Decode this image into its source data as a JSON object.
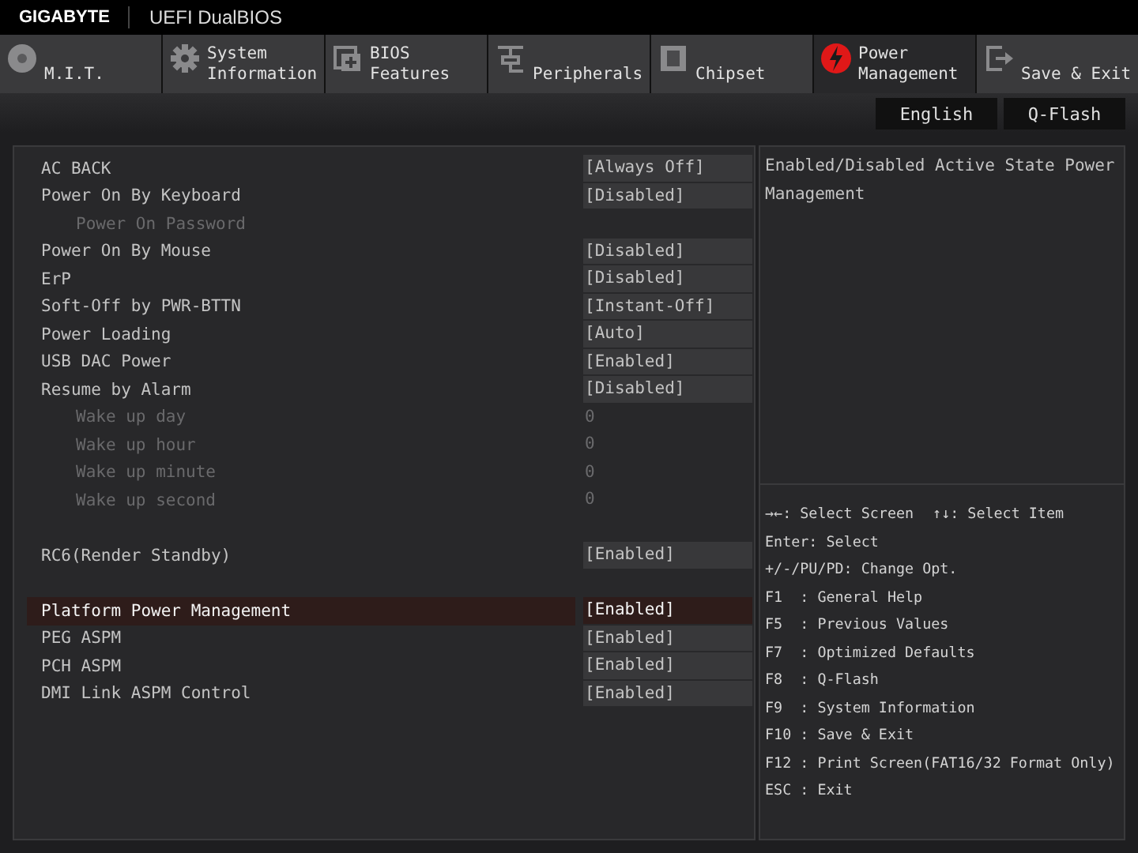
{
  "header": {
    "brand": "GIGABYTE",
    "product": "UEFI DualBIOS"
  },
  "tabs": [
    {
      "label": "M.I.T.",
      "selected": false
    },
    {
      "label": "System Information",
      "selected": false
    },
    {
      "label": "BIOS Features",
      "selected": false
    },
    {
      "label": "Peripherals",
      "selected": false
    },
    {
      "label": "Chipset",
      "selected": false
    },
    {
      "label": "Power Management",
      "selected": true
    },
    {
      "label": "Save & Exit",
      "selected": false
    }
  ],
  "top_buttons": [
    "English",
    "Q-Flash"
  ],
  "settings": [
    [
      {
        "label": "AC BACK",
        "value": "[Always Off]",
        "disabled": false,
        "selected": false
      },
      {
        "label": "Power On By Keyboard",
        "value": "[Disabled]",
        "disabled": false,
        "selected": false,
        "children": [
          {
            "label": "Power On Password",
            "disabled": true,
            "selected": false
          }
        ]
      },
      {
        "label": "Power On By Mouse",
        "value": "[Disabled]",
        "disabled": false,
        "selected": false
      },
      {
        "label": "ErP",
        "value": "[Disabled]",
        "disabled": false,
        "selected": false
      },
      {
        "label": "Soft-Off by PWR-BTTN",
        "value": "[Instant-Off]",
        "disabled": false,
        "selected": false
      },
      {
        "label": "Power Loading",
        "value": "[Auto]",
        "disabled": false,
        "selected": false
      },
      {
        "label": "USB DAC Power",
        "value": "[Enabled]",
        "disabled": false,
        "selected": false
      },
      {
        "label": "Resume by Alarm",
        "value": "[Disabled]",
        "disabled": false,
        "selected": false,
        "children": [
          {
            "label": "Wake up day",
            "value": "0",
            "disabled": true,
            "selected": false
          },
          {
            "label": "Wake up hour",
            "value": "0",
            "disabled": true,
            "selected": false
          },
          {
            "label": "Wake up minute",
            "value": "0",
            "disabled": true,
            "selected": false
          },
          {
            "label": "Wake up second",
            "value": "0",
            "disabled": true,
            "selected": false
          }
        ]
      }
    ],
    [
      {
        "label": "RC6(Render Standby)",
        "value": "[Enabled]",
        "disabled": false,
        "selected": false
      }
    ],
    [
      {
        "label": "Platform Power Management",
        "value": "[Enabled]",
        "disabled": false,
        "selected": true
      },
      {
        "label": "PEG ASPM",
        "value": "[Enabled]",
        "disabled": false,
        "selected": false
      },
      {
        "label": "PCH ASPM",
        "value": "[Enabled]",
        "disabled": false,
        "selected": false
      },
      {
        "label": "DMI Link ASPM Control",
        "value": "[Enabled]",
        "disabled": false,
        "selected": false
      }
    ]
  ],
  "description": "Enabled/Disabled Active State Power Management",
  "help": [
    [
      "→←: Select Screen",
      "↑↓: Select Item"
    ],
    [
      "Enter: Select"
    ],
    [
      "+/-/PU/PD: Change Opt."
    ],
    [
      "F1  : General Help"
    ],
    [
      "F5  : Previous Values"
    ],
    [
      "F7  : Optimized Defaults"
    ],
    [
      "F8  : Q-Flash"
    ],
    [
      "F9  : System Information"
    ],
    [
      "F10 : Save & Exit"
    ],
    [
      "F12 : Print Screen(FAT16/32 Format Only)"
    ],
    [
      "ESC : Exit"
    ]
  ]
}
